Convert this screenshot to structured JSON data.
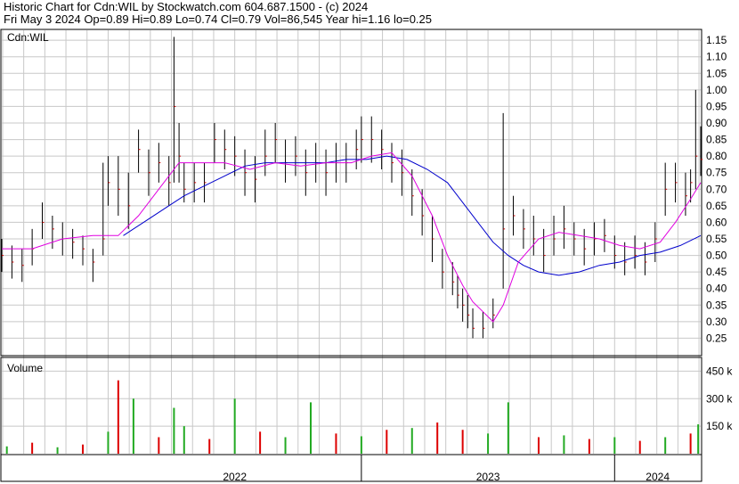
{
  "header": {
    "line1": "Historic Chart for Cdn:WIL by Stockwatch.com 604.687.1500 - (c) 2024",
    "line2": "Fri May  3 2024   Op=0.89  Hi=0.89  Lo=0.74  Cl=0.79  Vol=86,545  Year hi=1.16  lo=0.25"
  },
  "chart_data": {
    "type": "line",
    "symbol_label": "Cdn:WIL",
    "volume_label": "Volume",
    "price_axis": {
      "ylim": [
        0.2,
        1.18
      ],
      "ticks": [
        "1.15",
        "1.10",
        "1.05",
        "1.00",
        "0.95",
        "0.90",
        "0.85",
        "0.80",
        "0.75",
        "0.70",
        "0.65",
        "0.60",
        "0.55",
        "0.50",
        "0.45",
        "0.40",
        "0.35",
        "0.30",
        "0.25"
      ]
    },
    "volume_axis": {
      "ylim": [
        0,
        520
      ],
      "ticks": [
        "450 k",
        "300 k",
        "150 k"
      ]
    },
    "x_axis": {
      "labels": [
        "2022",
        "2023",
        "2024"
      ],
      "xlim": [
        2021.58,
        2024.34
      ]
    },
    "colors": {
      "price_bar": "#000000",
      "close_tick": "#cc0000",
      "ma_fast": "#e000e0",
      "ma_slow": "#0000cc",
      "vol_up": "#22aa22",
      "vol_down": "#dd0000",
      "grid": "#c8c8c8"
    },
    "price_series": {
      "name": "Price",
      "x": [
        2021.58,
        2021.62,
        2021.66,
        2021.7,
        2021.74,
        2021.78,
        2021.82,
        2021.86,
        2021.9,
        2021.94,
        2021.98,
        2022.0,
        2022.04,
        2022.08,
        2022.12,
        2022.16,
        2022.2,
        2022.24,
        2022.26,
        2022.28,
        2022.3,
        2022.34,
        2022.38,
        2022.42,
        2022.46,
        2022.5,
        2022.54,
        2022.58,
        2022.62,
        2022.66,
        2022.7,
        2022.74,
        2022.78,
        2022.82,
        2022.86,
        2022.9,
        2022.94,
        2022.98,
        2023.0,
        2023.04,
        2023.08,
        2023.12,
        2023.16,
        2023.2,
        2023.24,
        2023.28,
        2023.32,
        2023.36,
        2023.38,
        2023.4,
        2023.42,
        2023.44,
        2023.48,
        2023.52,
        2023.56,
        2023.6,
        2023.64,
        2023.68,
        2023.72,
        2023.76,
        2023.8,
        2023.84,
        2023.88,
        2023.92,
        2023.96,
        2024.0,
        2024.04,
        2024.08,
        2024.12,
        2024.16,
        2024.2,
        2024.24,
        2024.28,
        2024.3,
        2024.32,
        2024.34
      ],
      "y": [
        0.5,
        0.48,
        0.47,
        0.52,
        0.6,
        0.58,
        0.55,
        0.54,
        0.52,
        0.48,
        0.55,
        0.72,
        0.7,
        0.65,
        0.82,
        0.75,
        0.78,
        0.72,
        0.95,
        0.8,
        0.7,
        0.72,
        0.72,
        0.85,
        0.82,
        0.8,
        0.75,
        0.73,
        0.8,
        0.85,
        0.78,
        0.8,
        0.75,
        0.78,
        0.75,
        0.78,
        0.78,
        0.82,
        0.85,
        0.85,
        0.82,
        0.78,
        0.75,
        0.68,
        0.62,
        0.55,
        0.45,
        0.42,
        0.38,
        0.35,
        0.32,
        0.28,
        0.28,
        0.32,
        0.58,
        0.62,
        0.58,
        0.55,
        0.5,
        0.55,
        0.58,
        0.55,
        0.52,
        0.55,
        0.56,
        0.5,
        0.48,
        0.5,
        0.48,
        0.55,
        0.7,
        0.72,
        0.68,
        0.72,
        0.8,
        0.79
      ],
      "hi": [
        0.55,
        0.53,
        0.52,
        0.58,
        0.66,
        0.62,
        0.6,
        0.58,
        0.56,
        0.52,
        0.78,
        0.8,
        0.8,
        0.75,
        0.88,
        0.82,
        0.84,
        0.8,
        1.16,
        0.9,
        0.78,
        0.78,
        0.78,
        0.9,
        0.88,
        0.86,
        0.82,
        0.8,
        0.88,
        0.9,
        0.85,
        0.86,
        0.82,
        0.84,
        0.82,
        0.84,
        0.84,
        0.88,
        0.92,
        0.92,
        0.88,
        0.84,
        0.82,
        0.76,
        0.7,
        0.62,
        0.52,
        0.48,
        0.44,
        0.4,
        0.38,
        0.34,
        0.33,
        0.37,
        0.93,
        0.68,
        0.64,
        0.62,
        0.58,
        0.62,
        0.65,
        0.6,
        0.58,
        0.6,
        0.61,
        0.56,
        0.54,
        0.56,
        0.54,
        0.6,
        0.78,
        0.78,
        0.75,
        0.76,
        1.0,
        0.89
      ],
      "lo": [
        0.45,
        0.43,
        0.42,
        0.47,
        0.55,
        0.52,
        0.5,
        0.49,
        0.47,
        0.42,
        0.5,
        0.65,
        0.62,
        0.58,
        0.75,
        0.68,
        0.72,
        0.65,
        0.72,
        0.72,
        0.66,
        0.66,
        0.66,
        0.78,
        0.76,
        0.74,
        0.68,
        0.66,
        0.74,
        0.78,
        0.72,
        0.74,
        0.68,
        0.72,
        0.68,
        0.72,
        0.72,
        0.76,
        0.78,
        0.78,
        0.76,
        0.72,
        0.68,
        0.62,
        0.56,
        0.48,
        0.4,
        0.38,
        0.34,
        0.3,
        0.28,
        0.25,
        0.25,
        0.28,
        0.4,
        0.56,
        0.52,
        0.5,
        0.45,
        0.5,
        0.52,
        0.5,
        0.47,
        0.5,
        0.51,
        0.46,
        0.44,
        0.46,
        0.44,
        0.48,
        0.62,
        0.66,
        0.62,
        0.66,
        0.7,
        0.74
      ]
    },
    "ma_fast": {
      "x": [
        2021.58,
        2021.7,
        2021.82,
        2021.94,
        2022.04,
        2022.12,
        2022.2,
        2022.28,
        2022.36,
        2022.46,
        2022.56,
        2022.66,
        2022.76,
        2022.86,
        2022.96,
        2023.04,
        2023.12,
        2023.2,
        2023.28,
        2023.34,
        2023.4,
        2023.44,
        2023.48,
        2023.52,
        2023.56,
        2023.62,
        2023.7,
        2023.78,
        2023.86,
        2023.94,
        2024.02,
        2024.1,
        2024.18,
        2024.24,
        2024.3,
        2024.34
      ],
      "y": [
        0.52,
        0.52,
        0.55,
        0.56,
        0.56,
        0.62,
        0.7,
        0.78,
        0.78,
        0.78,
        0.76,
        0.78,
        0.77,
        0.78,
        0.78,
        0.8,
        0.81,
        0.74,
        0.62,
        0.5,
        0.41,
        0.36,
        0.33,
        0.3,
        0.35,
        0.48,
        0.55,
        0.57,
        0.56,
        0.55,
        0.53,
        0.52,
        0.54,
        0.6,
        0.67,
        0.72
      ]
    },
    "ma_slow": {
      "x": [
        2022.06,
        2022.14,
        2022.22,
        2022.3,
        2022.38,
        2022.46,
        2022.54,
        2022.62,
        2022.7,
        2022.78,
        2022.86,
        2022.94,
        2023.02,
        2023.1,
        2023.18,
        2023.26,
        2023.34,
        2023.4,
        2023.46,
        2023.52,
        2023.58,
        2023.64,
        2023.7,
        2023.78,
        2023.86,
        2023.94,
        2024.02,
        2024.1,
        2024.18,
        2024.26,
        2024.34
      ],
      "y": [
        0.56,
        0.6,
        0.64,
        0.68,
        0.71,
        0.74,
        0.77,
        0.78,
        0.78,
        0.78,
        0.78,
        0.79,
        0.79,
        0.8,
        0.79,
        0.76,
        0.72,
        0.66,
        0.6,
        0.54,
        0.5,
        0.47,
        0.45,
        0.44,
        0.45,
        0.47,
        0.48,
        0.5,
        0.51,
        0.53,
        0.56
      ]
    },
    "volume": {
      "x": [
        2021.6,
        2021.7,
        2021.8,
        2021.9,
        2022.0,
        2022.04,
        2022.1,
        2022.2,
        2022.26,
        2022.3,
        2022.4,
        2022.5,
        2022.6,
        2022.7,
        2022.8,
        2022.9,
        2023.0,
        2023.1,
        2023.2,
        2023.3,
        2023.4,
        2023.5,
        2023.58,
        2023.7,
        2023.8,
        2023.9,
        2024.0,
        2024.1,
        2024.2,
        2024.3,
        2024.33
      ],
      "values": [
        40,
        60,
        35,
        50,
        120,
        400,
        300,
        90,
        250,
        150,
        80,
        300,
        120,
        90,
        280,
        110,
        95,
        130,
        140,
        170,
        130,
        110,
        280,
        90,
        100,
        80,
        90,
        70,
        90,
        110,
        160
      ],
      "up": [
        true,
        false,
        true,
        false,
        true,
        false,
        true,
        false,
        true,
        true,
        false,
        true,
        false,
        true,
        true,
        false,
        true,
        false,
        true,
        false,
        false,
        true,
        true,
        false,
        true,
        false,
        true,
        false,
        true,
        false,
        true
      ]
    }
  }
}
